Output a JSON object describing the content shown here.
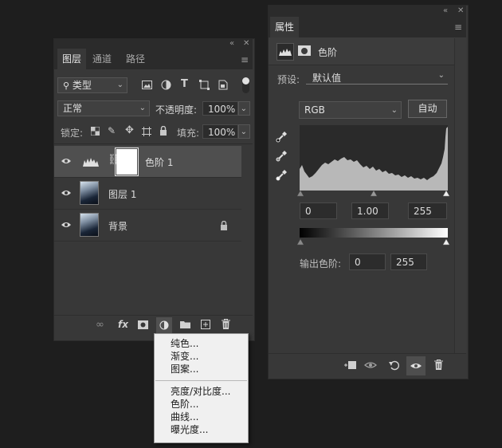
{
  "layers_panel": {
    "tabs": [
      "图层",
      "通道",
      "路径"
    ],
    "filter_kind": "类型",
    "blend_mode": "正常",
    "opacity_label": "不透明度:",
    "opacity_value": "100%",
    "lock_label": "锁定:",
    "fill_label": "填充:",
    "fill_value": "100%",
    "layers": [
      {
        "name": "色阶 1",
        "type": "adjustment",
        "selected": true
      },
      {
        "name": "图层 1",
        "type": "pixel",
        "selected": false
      },
      {
        "name": "背景",
        "type": "background",
        "locked": true,
        "selected": false
      }
    ],
    "bottom_icons": [
      "link-icon",
      "fx-icon",
      "mask-icon",
      "adjustment-icon",
      "folder-icon",
      "new-layer-icon",
      "trash-icon"
    ],
    "fx_label": "fx"
  },
  "adjustment_menu": {
    "items": [
      "纯色...",
      "渐变...",
      "图案...",
      "亮度/对比度...",
      "色阶...",
      "曲线...",
      "曝光度..."
    ]
  },
  "properties_panel": {
    "title": "属性",
    "adjustment_name": "色阶",
    "preset_label": "预设:",
    "preset_value": "默认值",
    "channel": "RGB",
    "auto_label": "自动",
    "input_black": "0",
    "input_gamma": "1.00",
    "input_white": "255",
    "output_label": "输出色阶:",
    "output_black": "0",
    "output_white": "255"
  },
  "colors": {
    "panel_bg": "#383838",
    "dark_bg": "#1e1e1e",
    "histogram_fill": "#b8b8b8",
    "menu_bg": "#f0f0f0"
  }
}
